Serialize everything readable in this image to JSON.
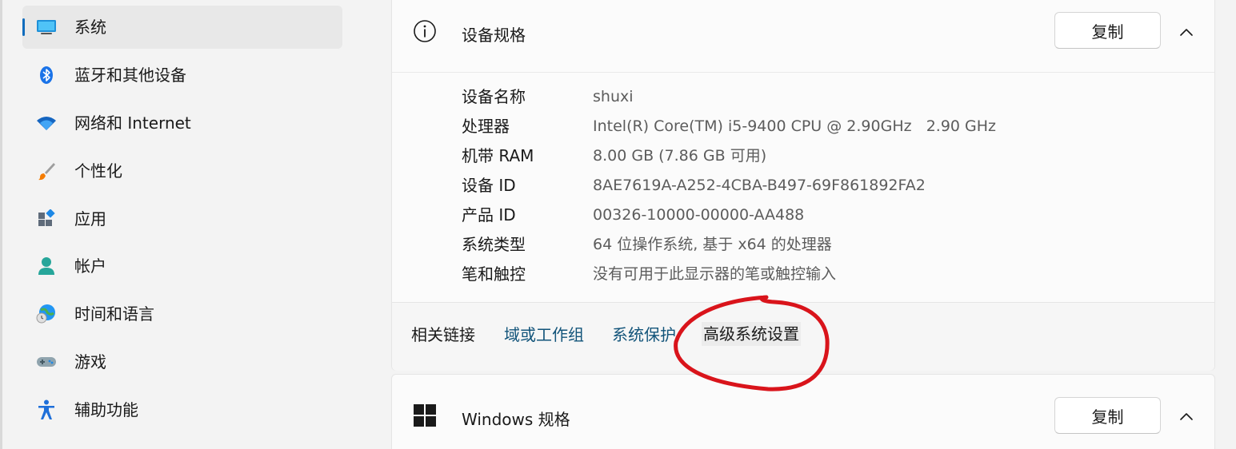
{
  "sidebar": {
    "items": [
      {
        "label": "系统",
        "icon": "system-monitor-icon",
        "active": true
      },
      {
        "label": "蓝牙和其他设备",
        "icon": "bluetooth-icon"
      },
      {
        "label": "网络和 Internet",
        "icon": "wifi-icon"
      },
      {
        "label": "个性化",
        "icon": "brush-icon"
      },
      {
        "label": "应用",
        "icon": "apps-icon"
      },
      {
        "label": "帐户",
        "icon": "account-icon"
      },
      {
        "label": "时间和语言",
        "icon": "time-language-icon"
      },
      {
        "label": "游戏",
        "icon": "gamepad-icon"
      },
      {
        "label": "辅助功能",
        "icon": "accessibility-icon"
      }
    ]
  },
  "device_specs": {
    "title": "设备规格",
    "copy_label": "复制",
    "rows": [
      {
        "label": "设备名称",
        "value": "shuxi"
      },
      {
        "label": "处理器",
        "value": "Intel(R) Core(TM) i5-9400 CPU @ 2.90GHz   2.90 GHz"
      },
      {
        "label": "机带 RAM",
        "value": "8.00 GB (7.86 GB 可用)"
      },
      {
        "label": "设备 ID",
        "value": "8AE7619A-A252-4CBA-B497-69F861892FA2"
      },
      {
        "label": "产品 ID",
        "value": "00326-10000-00000-AA488"
      },
      {
        "label": "系统类型",
        "value": "64 位操作系统, 基于 x64 的处理器"
      },
      {
        "label": "笔和触控",
        "value": "没有可用于此显示器的笔或触控输入"
      }
    ]
  },
  "related": {
    "label": "相关链接",
    "links": [
      "域或工作组",
      "系统保护",
      "高级系统设置"
    ]
  },
  "windows_specs": {
    "title": "Windows 规格",
    "copy_label": "复制"
  },
  "colors": {
    "accent": "#0f6cbd",
    "link": "#12547a",
    "annotation": "#d9141b"
  }
}
